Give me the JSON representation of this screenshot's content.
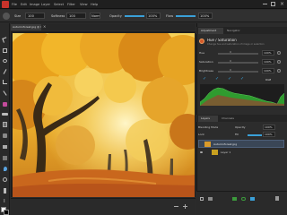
{
  "menubar": {
    "items": [
      "File",
      "Edit",
      "Image",
      "Layer",
      "Select",
      "Filter",
      "View",
      "Help"
    ]
  },
  "optionsbar": {
    "size_label": "Size",
    "size_value": "100",
    "softness_label": "Softness",
    "softness_value": "100",
    "opacity_label": "Opacity",
    "opacity_value": "100%",
    "flow_label": "Flow",
    "flow_value": "100%",
    "mode_value": "Normal",
    "mode_value_2": "100%"
  },
  "document": {
    "tab_title": "Autumnforest.jpg @ 100% (RGB, 8)"
  },
  "panel_top": {
    "tabs": [
      "Adjustment",
      "Navigator"
    ],
    "adjust_title": "Hue / Saturation",
    "adjust_subtitle": "Change hue and saturation of image or selection",
    "rows": [
      {
        "label": "Hue",
        "value": "0",
        "pct": "100%"
      },
      {
        "label": "Saturation",
        "value": "0",
        "pct": "100%"
      },
      {
        "label": "Brightness",
        "value": "0",
        "pct": "100%"
      }
    ],
    "reset_label": "RGB",
    "colors": {
      "histogram": "#2f9b2f",
      "accent": "#3aa0d8"
    }
  },
  "panel_layers": {
    "tabs": [
      "Layers",
      "Channels"
    ],
    "blend_mode": "Blending Mode",
    "opacity_label": "Opacity",
    "opacity_value": "100%",
    "lock_label": "Lock",
    "fill_label": "Fill",
    "fill_value": "100%",
    "layers": [
      {
        "name": "Autumnforest.jpg"
      },
      {
        "name": "Layer 1"
      }
    ]
  }
}
